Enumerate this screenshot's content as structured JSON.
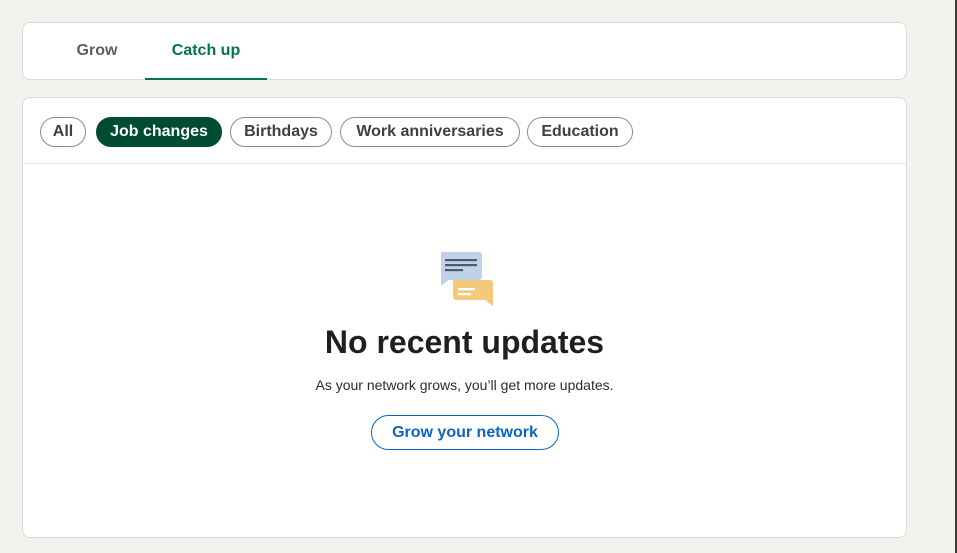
{
  "tabs": [
    {
      "label": "Grow",
      "active": false
    },
    {
      "label": "Catch up",
      "active": true
    }
  ],
  "filters": [
    {
      "label": "All",
      "active": false
    },
    {
      "label": "Job changes",
      "active": true
    },
    {
      "label": "Birthdays",
      "active": false
    },
    {
      "label": "Work anniversaries",
      "active": false
    },
    {
      "label": "Education",
      "active": false
    }
  ],
  "empty_state": {
    "icon": "chat-bubbles-icon",
    "title": "No recent updates",
    "subtitle": "As your network grows, you’ll get more updates.",
    "cta_label": "Grow your network"
  },
  "colors": {
    "accent_green": "#01754f",
    "active_pill": "#004c33",
    "link_blue": "#0a66c2",
    "bubble_blue": "#c1d2e8",
    "bubble_yellow": "#f5c97a",
    "page_bg": "#f4f2ee"
  }
}
